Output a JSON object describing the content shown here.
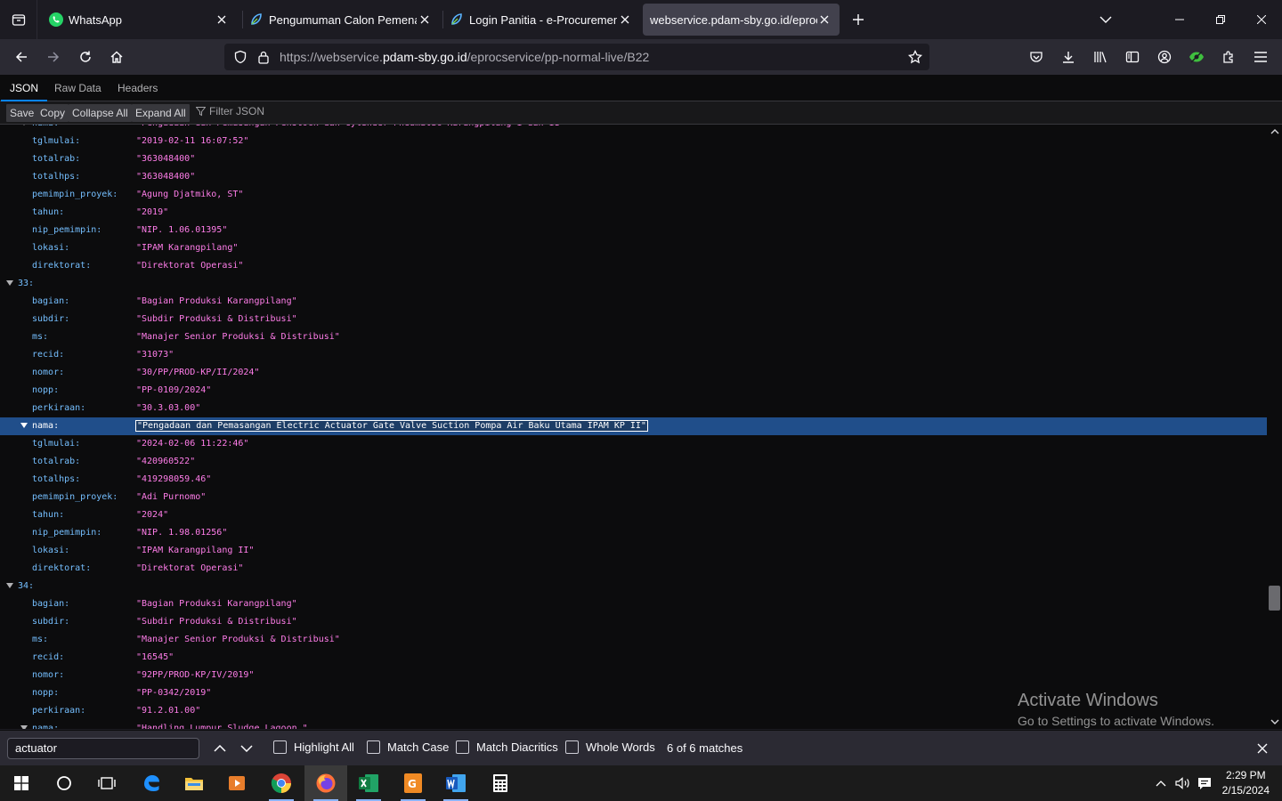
{
  "tabs": [
    {
      "title": "WhatsApp",
      "active": false
    },
    {
      "title": "Pengumuman Calon Pemenang",
      "active": false
    },
    {
      "title": "Login Panitia - e-Procurement PDAM",
      "active": false
    },
    {
      "title": "webservice.pdam-sby.go.id/eprocservice",
      "active": true
    }
  ],
  "url": {
    "prefix": "https://webservice.",
    "host": "pdam-sby.go.id",
    "path": "/eprocservice/pp-normal-live/B22"
  },
  "viewer_tabs": [
    "JSON",
    "Raw Data",
    "Headers"
  ],
  "toolbar": {
    "save": "Save",
    "copy": "Copy",
    "collapse": "Collapse All",
    "expand": "Expand All",
    "filter": "Filter JSON"
  },
  "json_rows": [
    {
      "key": "nama:",
      "value": "\"Pengadaan dan Pemasangan Penstock dan Cylinder Pneumatic Karangpilang I dan II\"",
      "expandable": true
    },
    {
      "key": "tglmulai:",
      "value": "\"2019-02-11 16:07:52\""
    },
    {
      "key": "totalrab:",
      "value": "\"363048400\""
    },
    {
      "key": "totalhps:",
      "value": "\"363048400\""
    },
    {
      "key": "pemimpin_proyek:",
      "value": "\"Agung Djatmiko, ST\""
    },
    {
      "key": "tahun:",
      "value": "\"2019\""
    },
    {
      "key": "nip_pemimpin:",
      "value": "\"NIP. 1.06.01395\""
    },
    {
      "key": "lokasi:",
      "value": "\"IPAM Karangpilang\""
    },
    {
      "key": "direktorat:",
      "value": "\"Direktorat Operasi\""
    },
    {
      "key": "33:",
      "value": "",
      "index": true
    },
    {
      "key": "bagian:",
      "value": "\"Bagian Produksi Karangpilang\""
    },
    {
      "key": "subdir:",
      "value": "\"Subdir Produksi & Distribusi\""
    },
    {
      "key": "ms:",
      "value": "\"Manajer Senior Produksi & Distribusi\""
    },
    {
      "key": "recid:",
      "value": "\"31073\""
    },
    {
      "key": "nomor:",
      "value": "\"30/PP/PROD-KP/II/2024\""
    },
    {
      "key": "nopp:",
      "value": "\"PP-0109/2024\""
    },
    {
      "key": "perkiraan:",
      "value": "\"30.3.03.00\""
    },
    {
      "key": "nama:",
      "value": "\"Pengadaan dan Pemasangan Electric Actuator Gate Valve Suction Pompa Air Baku Utama IPAM KP II\"",
      "expandable": true,
      "selected": true
    },
    {
      "key": "tglmulai:",
      "value": "\"2024-02-06 11:22:46\""
    },
    {
      "key": "totalrab:",
      "value": "\"420960522\""
    },
    {
      "key": "totalhps:",
      "value": "\"419298059.46\""
    },
    {
      "key": "pemimpin_proyek:",
      "value": "\"Adi Purnomo\""
    },
    {
      "key": "tahun:",
      "value": "\"2024\""
    },
    {
      "key": "nip_pemimpin:",
      "value": "\"NIP. 1.98.01256\""
    },
    {
      "key": "lokasi:",
      "value": "\"IPAM Karangpilang II\""
    },
    {
      "key": "direktorat:",
      "value": "\"Direktorat Operasi\""
    },
    {
      "key": "34:",
      "value": "",
      "index": true
    },
    {
      "key": "bagian:",
      "value": "\"Bagian Produksi Karangpilang\""
    },
    {
      "key": "subdir:",
      "value": "\"Subdir Produksi & Distribusi\""
    },
    {
      "key": "ms:",
      "value": "\"Manajer Senior Produksi & Distribusi\""
    },
    {
      "key": "recid:",
      "value": "\"16545\""
    },
    {
      "key": "nomor:",
      "value": "\"92PP/PROD-KP/IV/2019\""
    },
    {
      "key": "nopp:",
      "value": "\"PP-0342/2019\""
    },
    {
      "key": "perkiraan:",
      "value": "\"91.2.01.00\""
    },
    {
      "key": "nama:",
      "value": "\"Handling Lumpur Sludge Lagoon \"",
      "expandable": true
    }
  ],
  "watermark": {
    "line1": "Activate Windows",
    "line2": "Go to Settings to activate Windows."
  },
  "findbar": {
    "query": "actuator",
    "highlight_all": "Highlight All",
    "match_case": "Match Case",
    "match_diacritics": "Match Diacritics",
    "whole_words": "Whole Words",
    "status": "6 of 6 matches"
  },
  "clock": {
    "time": "2:29 PM",
    "date": "2/15/2024"
  },
  "colors": {
    "accent": "#0a84ff",
    "json_key": "#75bfff",
    "json_string": "#ff7de9",
    "selection": "#204e8a"
  }
}
